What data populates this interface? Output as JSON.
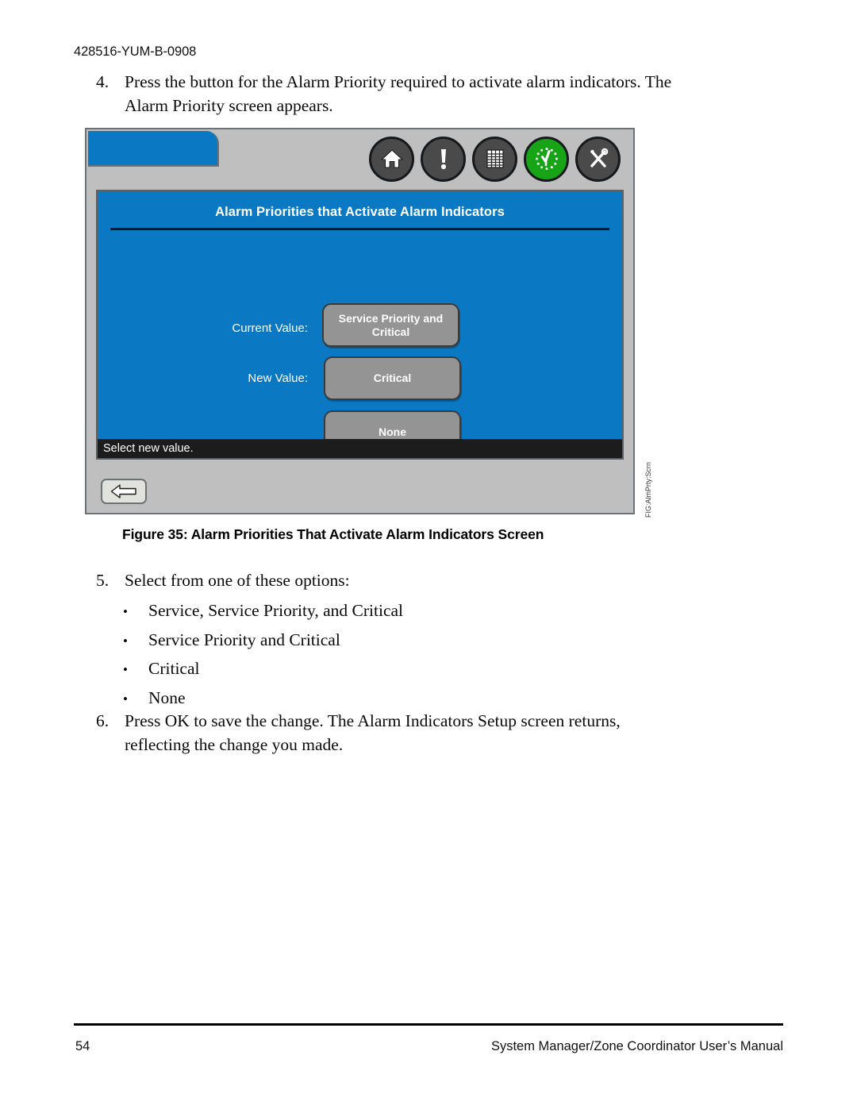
{
  "document": {
    "running_header": "428516-YUM-B-0908",
    "footer_page_number": "54",
    "footer_title": "System Manager/Zone Coordinator User’s Manual"
  },
  "steps": [
    {
      "number": "4.",
      "text": "Press the button for the Alarm Priority required to activate alarm indicators. The Alarm Priority screen appears."
    },
    {
      "number": "5.",
      "text": "Select from one of these options:"
    },
    {
      "number": "6.",
      "text": "Press OK to save the change. The Alarm Indicators Setup screen returns, reflecting the change you made."
    }
  ],
  "bullets": [
    {
      "marker": "•",
      "text": "Service, Service Priority, and Critical"
    },
    {
      "marker": "•",
      "text": "Service Priority and Critical"
    },
    {
      "marker": "•",
      "text": "Critical"
    },
    {
      "marker": "•",
      "text": "None"
    }
  ],
  "figure": {
    "caption": "Figure 35: Alarm Priorities That Activate Alarm Indicators Screen",
    "margin_note": "FIG:AlmPrty:Scrn",
    "screen": {
      "title": "Alarm Priorities that Activate Alarm Indicators",
      "labels": {
        "current_value": "Current Value:",
        "new_value": "New Value:"
      },
      "buttons": {
        "current_value": "Service Priority and Critical",
        "new_value": "Critical",
        "none": "None"
      },
      "status_text": "Select new value.",
      "back_button_label": "Back"
    },
    "toolbar_icons": [
      {
        "name": "home-icon",
        "glyph": "home"
      },
      {
        "name": "alarm-icon",
        "glyph": "exclamation"
      },
      {
        "name": "schedule-grid-icon",
        "glyph": "grid"
      },
      {
        "name": "clock-status-icon",
        "glyph": "clock"
      },
      {
        "name": "tools-icon",
        "glyph": "tools"
      }
    ]
  },
  "colors": {
    "screen_blue": "#0a78c2",
    "panel_gray": "#bfbfbf",
    "button_gray": "#949494",
    "status_bar": "#1c1c1c",
    "icon_dark": "#4a4a4a",
    "icon_green": "#17a517"
  }
}
